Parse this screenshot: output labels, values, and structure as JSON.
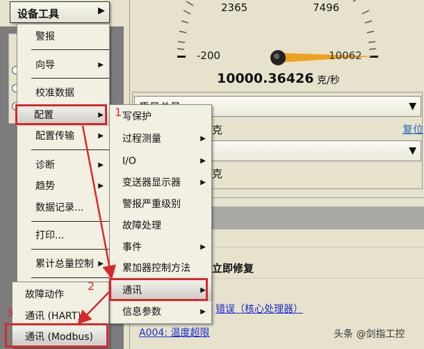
{
  "gauge": {
    "ticks": [
      "2365",
      "7496",
      "-200",
      "10062"
    ],
    "value": "10000.36426",
    "unit": "克/秒",
    "needle_fraction": 0.98
  },
  "panel": {
    "dropdown1": "质量总量",
    "unit1": "克",
    "reset_link": "复位",
    "dropdown2": "",
    "unit2": "克"
  },
  "alerts": {
    "heading": "立即修复",
    "link1": "错误（核心处理器）",
    "link2": "A004: 温度超限"
  },
  "menu": {
    "title": "设备工具",
    "items": [
      "警报",
      "向导",
      "校准数据",
      "配置",
      "配置传输",
      "诊断",
      "趋势",
      "数据记录...",
      "打印...",
      "累计总量控制"
    ]
  },
  "submenu": {
    "items": [
      "写保护",
      "过程测量",
      "I/O",
      "变送器显示器",
      "警报严重级别",
      "故障处理",
      "事件",
      "累加器控制方法",
      "通讯",
      "信息参数"
    ]
  },
  "submenu2": {
    "items": [
      "故障动作",
      "通讯 (HART)",
      "通讯 (Modbus)"
    ]
  },
  "annotations": {
    "step1": "1",
    "step2": "2",
    "step3": "3"
  },
  "watermark": "头条 @剑指工控",
  "colors": {
    "annotation": "#d8282c",
    "needle": "#f0a020"
  }
}
